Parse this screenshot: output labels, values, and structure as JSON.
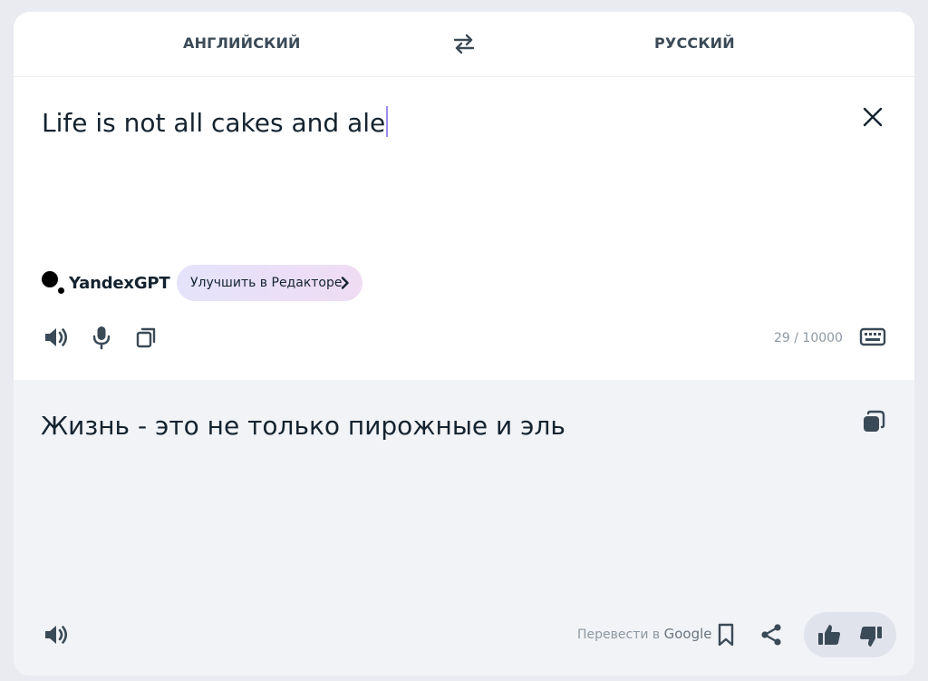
{
  "languages": {
    "source": "АНГЛИЙСКИЙ",
    "target": "РУССКИЙ"
  },
  "source": {
    "text": "Life is not all cakes and ale",
    "counter": "29 / 10000"
  },
  "gpt": {
    "brand": "YandexGPT",
    "improve_label": "Улучшить в Редакторе"
  },
  "translation": {
    "text": "Жизнь - это не только пирожные и эль",
    "google_prefix": "Перевести в",
    "google_name": "Google"
  },
  "icons": [
    "swap-icon",
    "clear-icon",
    "speaker-icon",
    "microphone-icon",
    "copy-icon",
    "keyboard-icon",
    "bookmark-icon",
    "share-icon",
    "thumbs-up-icon",
    "thumbs-down-icon"
  ],
  "colors": {
    "text": "#14232f",
    "muted": "#8e98a3",
    "caret": "#9c8cf0",
    "translation_bg": "#f2f3f7",
    "page_bg": "#e9ebf0"
  }
}
